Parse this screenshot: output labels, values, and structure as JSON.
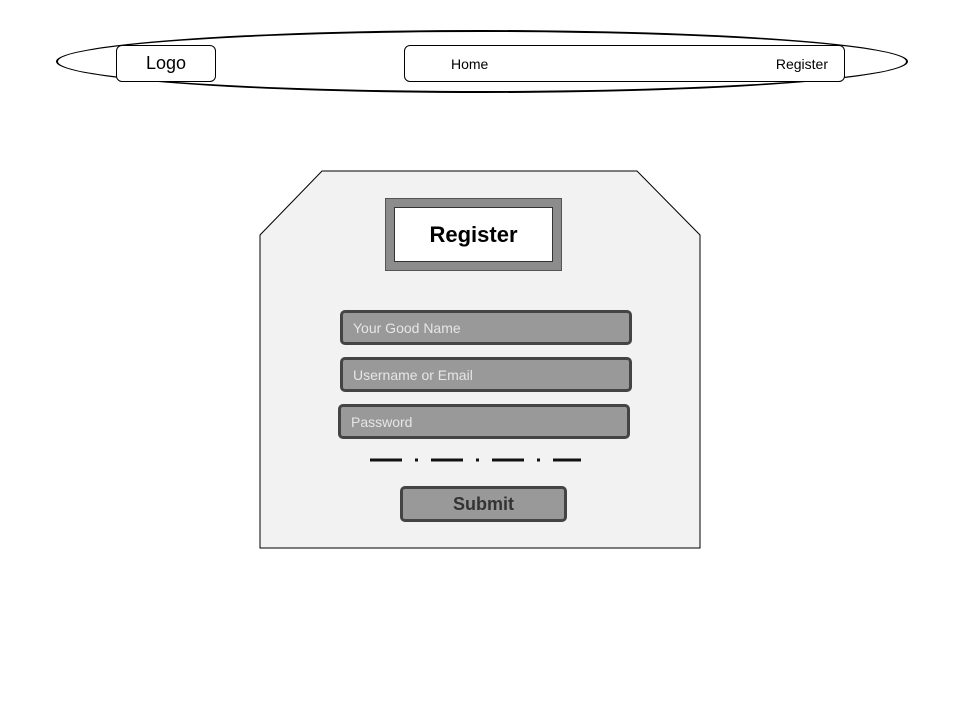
{
  "header": {
    "logo_label": "Logo",
    "nav": {
      "home_label": "Home",
      "register_label": "Register"
    }
  },
  "form": {
    "title": "Register",
    "fields": {
      "name_placeholder": "Your Good Name",
      "username_placeholder": "Username or Email",
      "password_placeholder": "Password"
    },
    "submit_label": "Submit"
  },
  "colors": {
    "card_background": "#f2f2f2",
    "field_fill": "#999999",
    "field_border": "#444444",
    "placeholder_text": "#e6e6e6"
  }
}
